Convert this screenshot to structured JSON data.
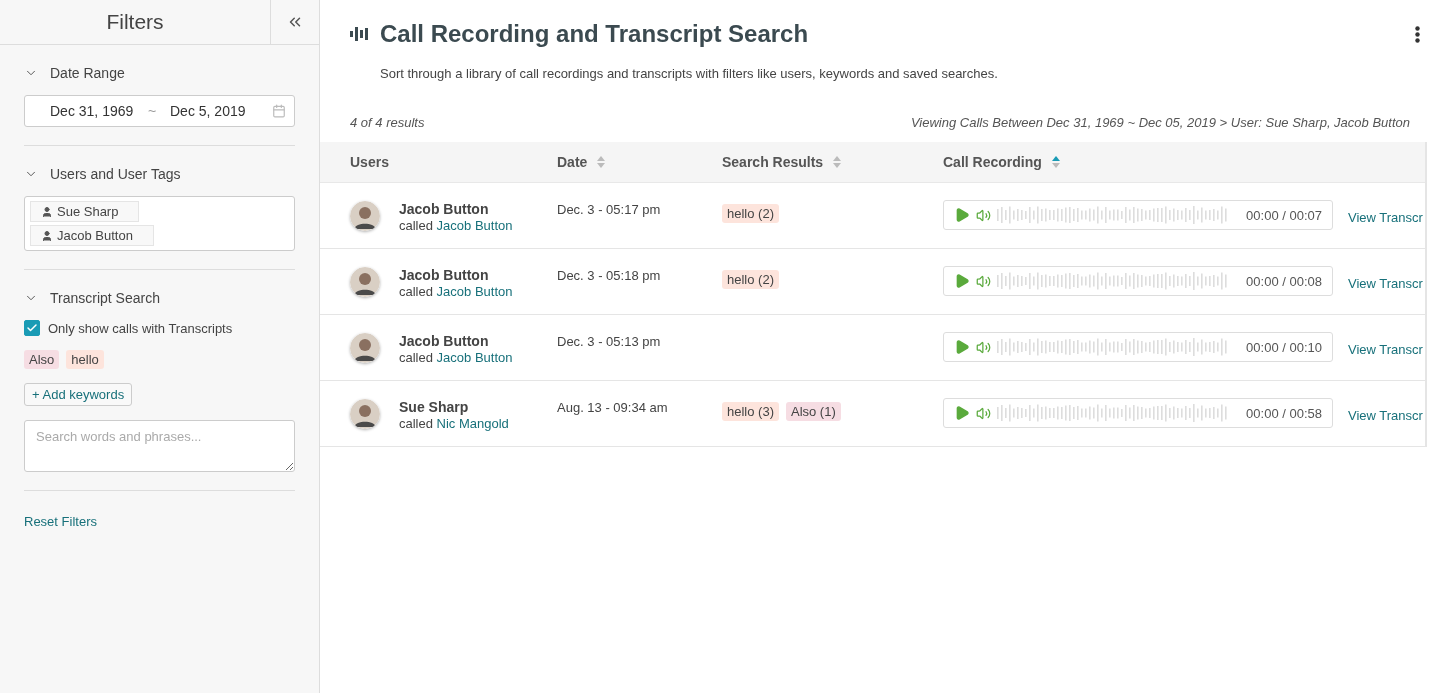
{
  "sidebar": {
    "title": "Filters",
    "date_range": {
      "title": "Date Range",
      "expanded": true,
      "start": "Dec 31, 1969",
      "separator": "~",
      "end": "Dec 5, 2019"
    },
    "users": {
      "title": "Users and User Tags",
      "expanded": true,
      "tags": [
        "Sue Sharp",
        "Jacob Button"
      ]
    },
    "transcript": {
      "title": "Transcript Search",
      "expanded": true,
      "checkbox": {
        "label": "Only show calls with Transcripts",
        "checked": true
      },
      "keywords": [
        {
          "label": "Also",
          "color": "#f6dde3"
        },
        {
          "label": "hello",
          "color": "#fde4dc"
        }
      ],
      "add_button": "+ Add keywords",
      "search": {
        "placeholder": "Search words and phrases..."
      }
    },
    "reset": "Reset Filters"
  },
  "main": {
    "title": "Call Recording and Transcript Search",
    "description": "Sort through a library of call recordings and transcripts with filters like users, keywords and saved searches.",
    "count": "4 of 4 results",
    "breadcrumb": "Viewing Calls Between Dec 31, 1969 ~ Dec 05, 2019 > User: Sue Sharp, Jacob Button",
    "columns": [
      {
        "label": "Users",
        "sortable": false
      },
      {
        "label": "Date",
        "sortable": true,
        "ascending": false
      },
      {
        "label": "Search Results",
        "sortable": true,
        "ascending": false
      },
      {
        "label": "Call Recording",
        "sortable": true,
        "ascending": true
      }
    ],
    "rows": [
      {
        "user": "Jacob Button",
        "called": "called",
        "callee": "Jacob Button",
        "date": "Dec. 3 - 05:17 pm",
        "results": [
          {
            "label": "hello (2)",
            "color": "#fde4dc"
          }
        ],
        "time": "00:00 / 00:07",
        "link": "View Transcr"
      },
      {
        "user": "Jacob Button",
        "called": "called",
        "callee": "Jacob Button",
        "date": "Dec. 3 - 05:18 pm",
        "results": [
          {
            "label": "hello (2)",
            "color": "#fde4dc"
          }
        ],
        "time": "00:00 / 00:08",
        "link": "View Transcr"
      },
      {
        "user": "Jacob Button",
        "called": "called",
        "callee": "Jacob Button",
        "date": "Dec. 3 - 05:13 pm",
        "results": [],
        "time": "00:00 / 00:10",
        "link": "View Transcr"
      },
      {
        "user": "Sue Sharp",
        "called": "called",
        "callee": "Nic Mangold",
        "date": "Aug. 13 - 09:34 am",
        "results": [
          {
            "label": "hello (3)",
            "color": "#fde4dc"
          },
          {
            "label": "Also (1)",
            "color": "#f6dde3"
          }
        ],
        "time": "00:00 / 00:58",
        "link": "View Transcr"
      }
    ]
  }
}
